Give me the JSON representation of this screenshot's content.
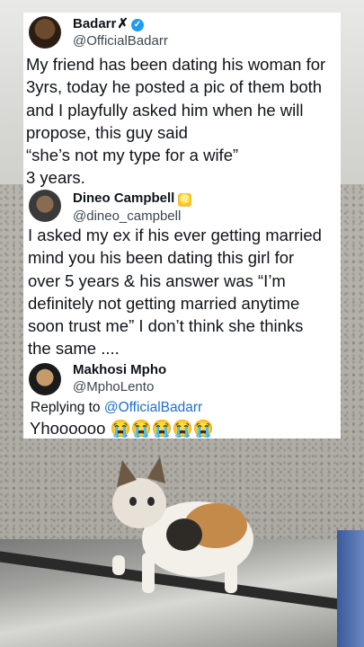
{
  "post1": {
    "name": "Badarr",
    "handle": "@OfficialBadarr",
    "lines": [
      "My friend has been dating his woman for",
      "3yrs, today he posted a pic of them both",
      "and I playfully asked him when he will",
      "propose, this guy said",
      "“she’s not my type for a wife”",
      "3 years."
    ]
  },
  "post2": {
    "name": "Dineo Campbell",
    "handle": "@dineo_campbell",
    "lines": [
      "I asked my ex if his ever getting married",
      "mind you his been dating this girl for",
      "over 5 years & his answer was “I’m",
      "definitely not getting married anytime",
      "soon trust me” I don’t think she thinks",
      "the same ...."
    ]
  },
  "post3": {
    "name": "Makhosi Mpho",
    "handle": "@MphoLento",
    "replying_prefix": "Replying to ",
    "replying_to": "@OfficialBadarr",
    "text": "Yhoooooo 😭😭😭😭😭"
  }
}
